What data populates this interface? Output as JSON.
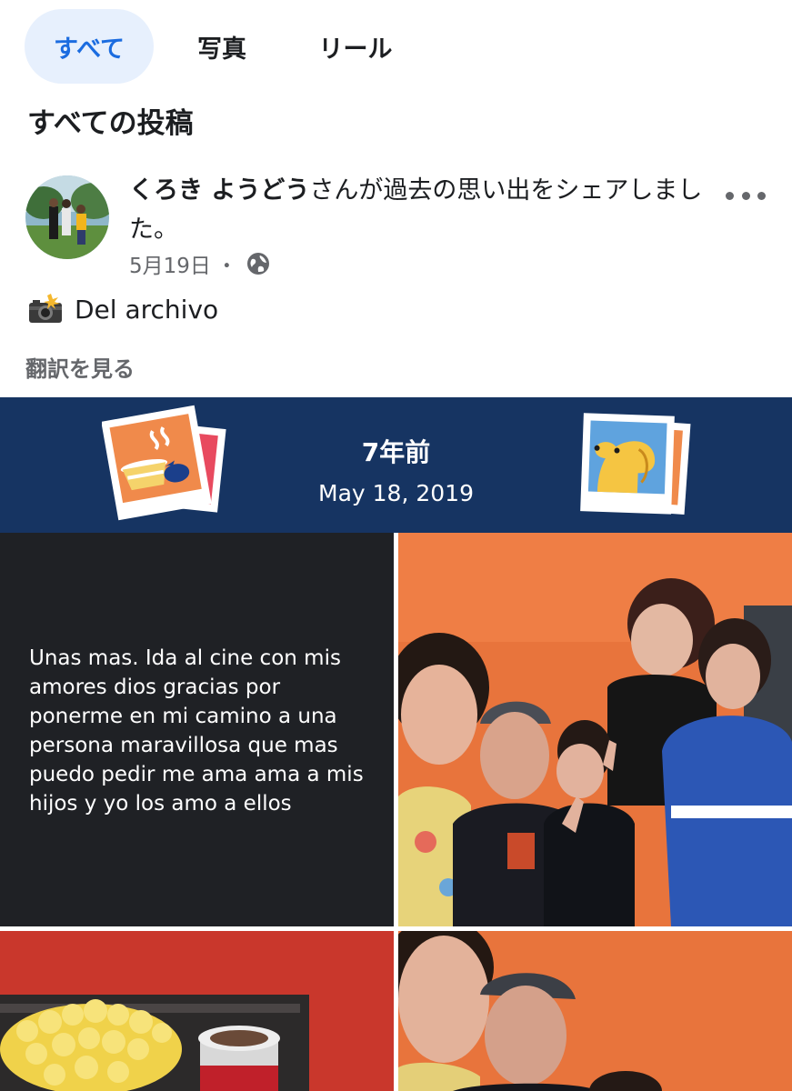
{
  "tabs": [
    {
      "label": "すべて",
      "active": true
    },
    {
      "label": "写真",
      "active": false
    },
    {
      "label": "リール",
      "active": false
    }
  ],
  "section_title": "すべての投稿",
  "post": {
    "author": "くろき ようどう",
    "action": "さんが過去の思い出をシェアしました。",
    "date": "5月19日",
    "separator": "・",
    "privacy_icon": "globe-icon",
    "more_icon": "more-options-icon",
    "caption_icon": "camera-flash-icon",
    "caption": "Del archivo",
    "translate_link": "翻訳を見る"
  },
  "memory": {
    "years_ago": "7年前",
    "date": "May 18, 2019",
    "background_color": "#163462"
  },
  "grid": {
    "text_post": "Unas mas. Ida al cine con mis amores dios gracias por ponerme en mi camino a una persona maravillosa que mas puedo pedir me ama ama a mis hijos y yo los amo a ellos"
  },
  "colors": {
    "active_tab_bg": "#e7f0fd",
    "active_tab_text": "#1b6ce0",
    "secondary_text": "#65676b",
    "text_cell_bg": "#1f2125"
  }
}
